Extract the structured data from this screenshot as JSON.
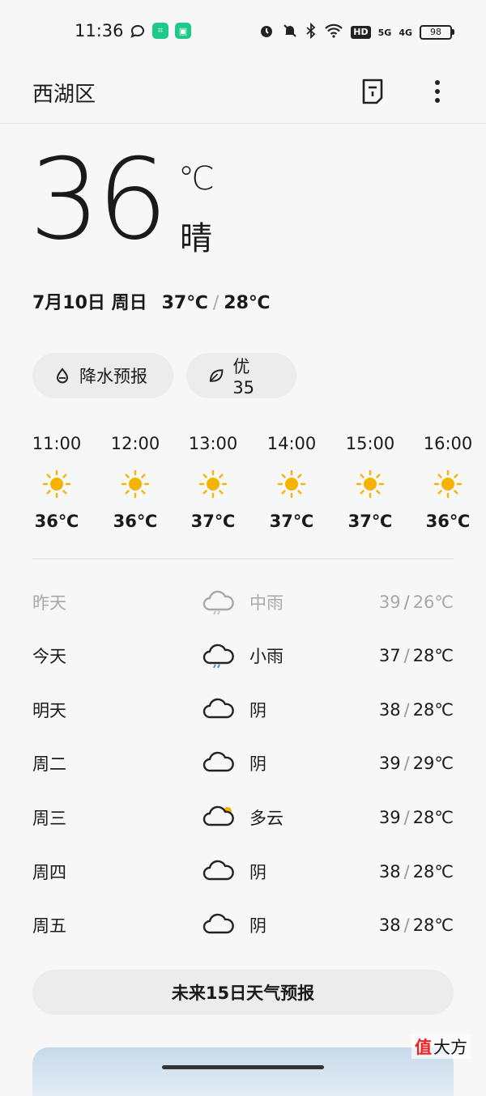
{
  "status_bar": {
    "time": "11:36",
    "hd_label": "HD",
    "sig1": "5G",
    "sig2": "4G",
    "battery": "98"
  },
  "header": {
    "title": "西湖区",
    "doc_icon": "document-icon",
    "more_icon": "more-vertical-icon"
  },
  "current": {
    "temp": "36",
    "unit": "℃",
    "condition": "晴",
    "date": "7月10日 周日",
    "high": "37℃",
    "low": "28℃",
    "slash": "/"
  },
  "pills": {
    "rain_label": "降水预报",
    "aqi_label": "优 35"
  },
  "hourly": [
    {
      "time": "11:00",
      "icon": "sun-icon",
      "temp": "36℃"
    },
    {
      "time": "12:00",
      "icon": "sun-icon",
      "temp": "36℃"
    },
    {
      "time": "13:00",
      "icon": "sun-icon",
      "temp": "37℃"
    },
    {
      "time": "14:00",
      "icon": "sun-icon",
      "temp": "37℃"
    },
    {
      "time": "15:00",
      "icon": "sun-icon",
      "temp": "37℃"
    },
    {
      "time": "16:00",
      "icon": "sun-icon",
      "temp": "36℃"
    }
  ],
  "daily": [
    {
      "day": "昨天",
      "icon": "rain-cloud-icon",
      "cond": "中雨",
      "high": "39",
      "low": "26℃"
    },
    {
      "day": "今天",
      "icon": "rain-cloud-icon",
      "cond": "小雨",
      "high": "37",
      "low": "28℃"
    },
    {
      "day": "明天",
      "icon": "cloud-icon",
      "cond": "阴",
      "high": "38",
      "low": "28℃"
    },
    {
      "day": "周二",
      "icon": "cloud-icon",
      "cond": "阴",
      "high": "39",
      "low": "29℃"
    },
    {
      "day": "周三",
      "icon": "partly-cloudy-icon",
      "cond": "多云",
      "high": "39",
      "low": "28℃"
    },
    {
      "day": "周四",
      "icon": "cloud-icon",
      "cond": "阴",
      "high": "38",
      "low": "28℃"
    },
    {
      "day": "周五",
      "icon": "cloud-icon",
      "cond": "阴",
      "high": "38",
      "low": "28℃"
    }
  ],
  "forecast_button": "未来15日天气预报",
  "watermark": {
    "badge": "值",
    "text": "大方"
  },
  "colors": {
    "sun": "#f5b400",
    "accent_rain": "#4a90d9",
    "muted": "#a8a8a8"
  }
}
